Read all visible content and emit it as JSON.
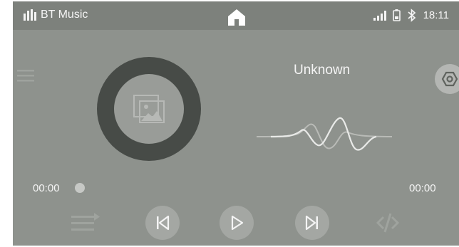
{
  "status_bar": {
    "app_title": "BT Music",
    "time": "18:11",
    "icons": [
      "equalizer-bars-icon",
      "home-icon",
      "signal-icon",
      "battery-icon",
      "bluetooth-icon"
    ]
  },
  "player": {
    "song_title": "Unknown",
    "elapsed_time": "00:00",
    "total_time": "00:00",
    "progress": 0
  },
  "controls": {
    "icons": [
      "playlist-icon",
      "previous-icon",
      "play-icon",
      "next-icon",
      "repeat-off-icon"
    ]
  },
  "colors": {
    "screen_background": "#8e928d",
    "status_bar": "#7d817c",
    "disc": "#474b47",
    "text": "#f4f4f4",
    "button": "#a4a7a3"
  }
}
